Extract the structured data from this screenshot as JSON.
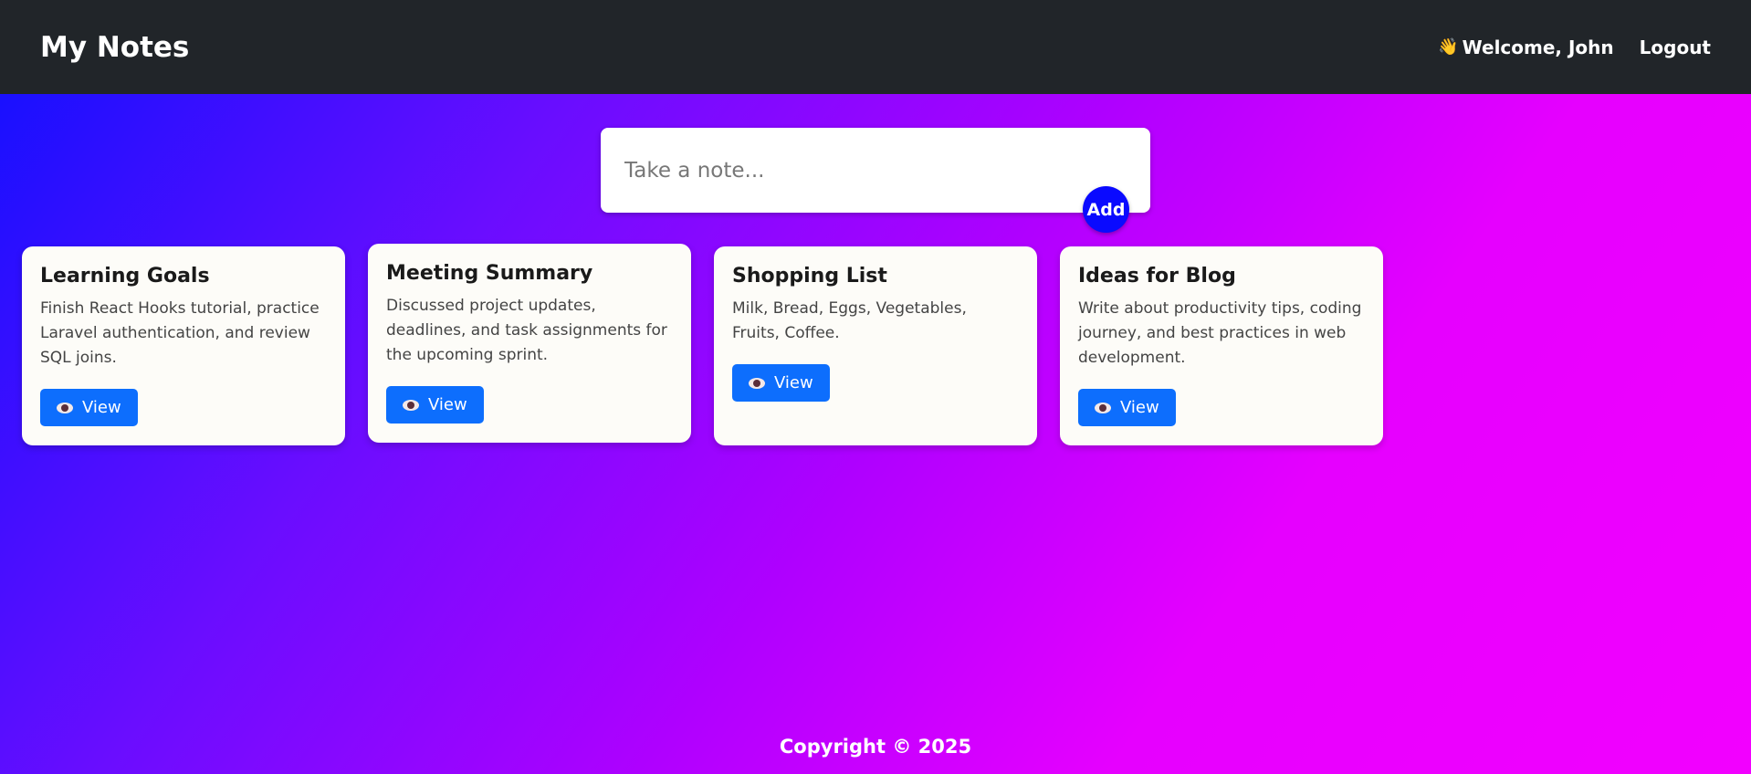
{
  "navbar": {
    "brand": "My Notes",
    "welcome_icon": "waving-hand-icon",
    "welcome_text": "Welcome, John",
    "logout_label": "Logout",
    "background": "#212529"
  },
  "composer": {
    "placeholder": "Take a note...",
    "value": "",
    "add_label": "Add",
    "add_color": "#0a0aff"
  },
  "notes": [
    {
      "title": "Learning Goals",
      "body": "Finish React Hooks tutorial, practice Laravel authentication, and review SQL joins.",
      "view_label": "View"
    },
    {
      "title": "Meeting Summary",
      "body": "Discussed project updates, deadlines, and task assignments for the upcoming sprint.",
      "view_label": "View"
    },
    {
      "title": "Shopping List",
      "body": "Milk, Bread, Eggs, Vegetables, Fruits, Coffee.",
      "view_label": "View"
    },
    {
      "title": "Ideas for Blog",
      "body": "Write about productivity tips, coding journey, and best practices in web development.",
      "view_label": "View"
    }
  ],
  "footer": {
    "copyright": "Copyright © 2025"
  },
  "colors": {
    "accent": "#0d6efd",
    "gradient_start": "#1010ff",
    "gradient_end": "#f200ff"
  }
}
